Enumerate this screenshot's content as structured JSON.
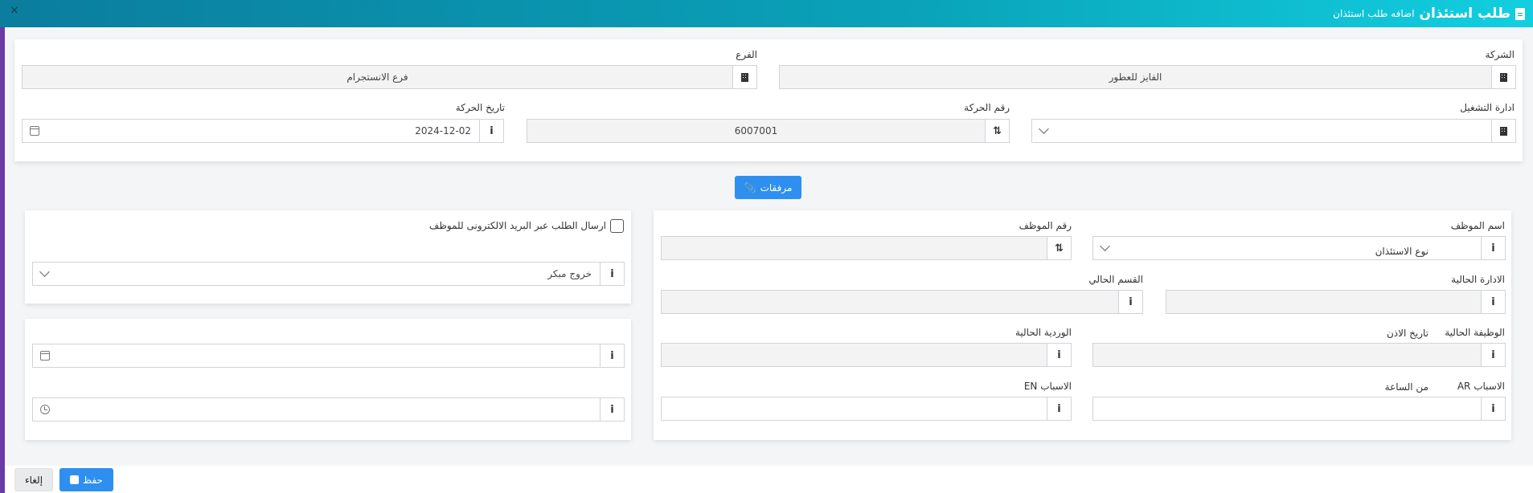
{
  "header": {
    "title": "طلب استئذان",
    "subtitle": "اضافه طلب استئذان",
    "close_glyph": "×"
  },
  "top_form": {
    "company": {
      "label": "الشركة",
      "value": "الفايز للعطور"
    },
    "branch": {
      "label": "الفرع",
      "value": "فرع الانستجرام"
    },
    "operations_dept": {
      "label": "ادارة التشغيل",
      "value": ""
    },
    "movement_number": {
      "label": "رقم الحركة",
      "value": "6007001"
    },
    "movement_date": {
      "label": "تاريخ الحركة",
      "value": "2024-12-02"
    }
  },
  "attachments_button": {
    "label": "مرفقات",
    "icon": "paperclip-icon"
  },
  "employee_form": {
    "employee_name": {
      "label": "اسم الموظف",
      "value": ""
    },
    "employee_number": {
      "label": "رقم الموظف",
      "value": ""
    },
    "current_department": {
      "label": "الادارة الحالية",
      "value": ""
    },
    "current_section": {
      "label": "القسم الحالي",
      "value": ""
    },
    "current_job": {
      "label": "الوظيفة الحالية",
      "value": ""
    },
    "current_shift": {
      "label": "الوردية الحالية",
      "value": ""
    },
    "reasons_ar": {
      "label": "الاسباب AR",
      "value": ""
    },
    "reasons_en": {
      "label": "الاسباب EN",
      "value": ""
    }
  },
  "request_form": {
    "send_email": {
      "label": "ارسال الطلب عبر البريد الالكترونى للموظف",
      "checked": false
    },
    "permission_type": {
      "label": "نوع الاستئذان",
      "value": "خروج مبكر"
    }
  },
  "time_form": {
    "permission_date": {
      "label": "تاريخ الاذن",
      "value": ""
    },
    "from_time": {
      "label": "من الساعة",
      "value": ""
    }
  },
  "footer": {
    "save_label": "حفظ",
    "cancel_label": "إلغاء"
  },
  "icons": {
    "info": "i",
    "sort": "⇅"
  },
  "colors": {
    "header_start": "#0b7d9e",
    "header_end": "#12cfe0",
    "primary_button": "#2e8ff0",
    "left_accent": "#6a3aa7"
  }
}
